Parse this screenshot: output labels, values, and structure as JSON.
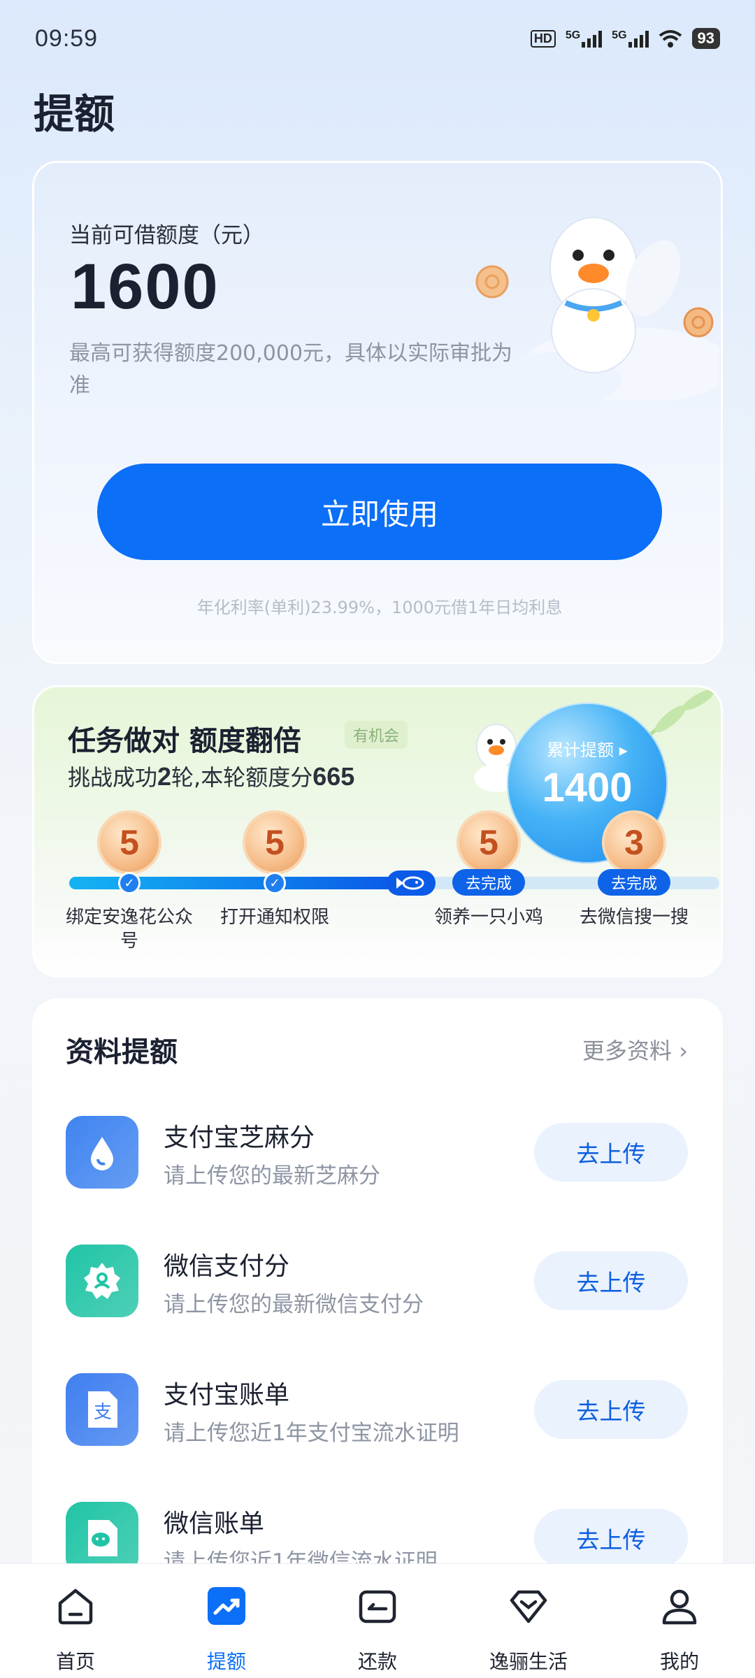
{
  "status_bar": {
    "time": "09:59",
    "network1": "5G",
    "network2": "5G",
    "hd": "HD",
    "battery": "93"
  },
  "page": {
    "title": "提额"
  },
  "quota": {
    "label": "当前可借额度（元）",
    "amount": "1600",
    "description": "最高可获得额度200,000元，具体以实际审批为准",
    "button_label": "立即使用",
    "rate_note": "年化利率(单利)23.99%，1000元借1年日均利息"
  },
  "task": {
    "title": "任务做对 额度翻倍",
    "badge": "有机会",
    "subtitle_prefix": "挑战成功",
    "rounds": "2",
    "subtitle_mid": "轮,本轮额度分",
    "score": "665",
    "progress_fraction": 0.5,
    "bubble_label": "累计提额 ▸",
    "bubble_value": "1400",
    "steps": [
      {
        "points": "5",
        "label": "绑定安逸花公众号",
        "status": "done"
      },
      {
        "points": "5",
        "label": "打开通知权限",
        "status": "done"
      },
      {
        "points": "5",
        "label": "领养一只小鸡",
        "status": "todo",
        "action": "去完成"
      },
      {
        "points": "3",
        "label": "去微信搜一搜",
        "status": "todo",
        "action": "去完成"
      }
    ]
  },
  "materials": {
    "title": "资料提额",
    "more_label": "更多资料 ›",
    "items": [
      {
        "title": "支付宝芝麻分",
        "subtitle": "请上传您的最新芝麻分",
        "button": "去上传",
        "icon": "sesame-icon",
        "color": "#3f84f0"
      },
      {
        "title": "微信支付分",
        "subtitle": "请上传您的最新微信支付分",
        "button": "去上传",
        "icon": "wechat-pay-score-icon",
        "color": "#21c4a6"
      },
      {
        "title": "支付宝账单",
        "subtitle": "请上传您近1年支付宝流水证明",
        "button": "去上传",
        "icon": "alipay-bill-icon",
        "color": "#3f7ff0"
      },
      {
        "title": "微信账单",
        "subtitle": "请上传您近1年微信流水证明",
        "button": "去上传",
        "icon": "wechat-bill-icon",
        "color": "#21c4a6"
      }
    ]
  },
  "nav": {
    "active_index": 1,
    "items": [
      {
        "label": "首页",
        "icon": "home-icon"
      },
      {
        "label": "提额",
        "icon": "trend-up-icon"
      },
      {
        "label": "还款",
        "icon": "repay-icon"
      },
      {
        "label": "逸骊生活",
        "icon": "diamond-icon"
      },
      {
        "label": "我的",
        "icon": "user-icon"
      }
    ]
  }
}
